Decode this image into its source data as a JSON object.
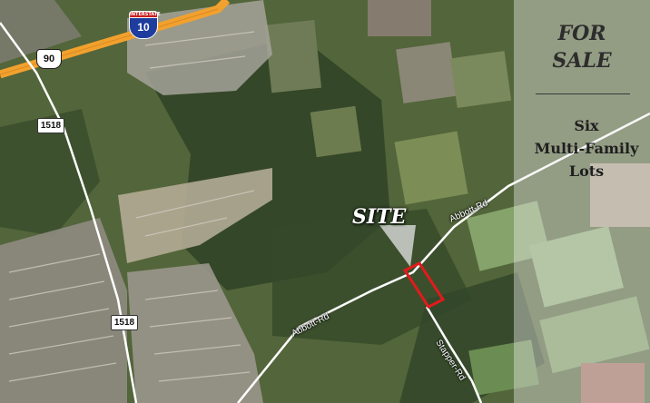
{
  "map": {
    "highway_shield": {
      "route": "10",
      "label": "INTERSTATE"
    },
    "us_route_shield": {
      "route": "90"
    },
    "farm_market_shields": [
      {
        "route": "1518"
      },
      {
        "route": "1518"
      }
    ],
    "road_labels": {
      "abbott_rd_east": "Abbott-Rd",
      "abbott_rd_west": "Abbott-Rd",
      "stapper_rd": "Stapper-Rd"
    },
    "site_label": "SITE",
    "parcel_outline_color": "#e01b1b",
    "highway_color": "#f2a12e"
  },
  "panel": {
    "title_line1": "FOR",
    "title_line2": "SALE",
    "desc_line1": "Six",
    "desc_line2": "Multi-Family",
    "desc_line3": "Lots"
  }
}
